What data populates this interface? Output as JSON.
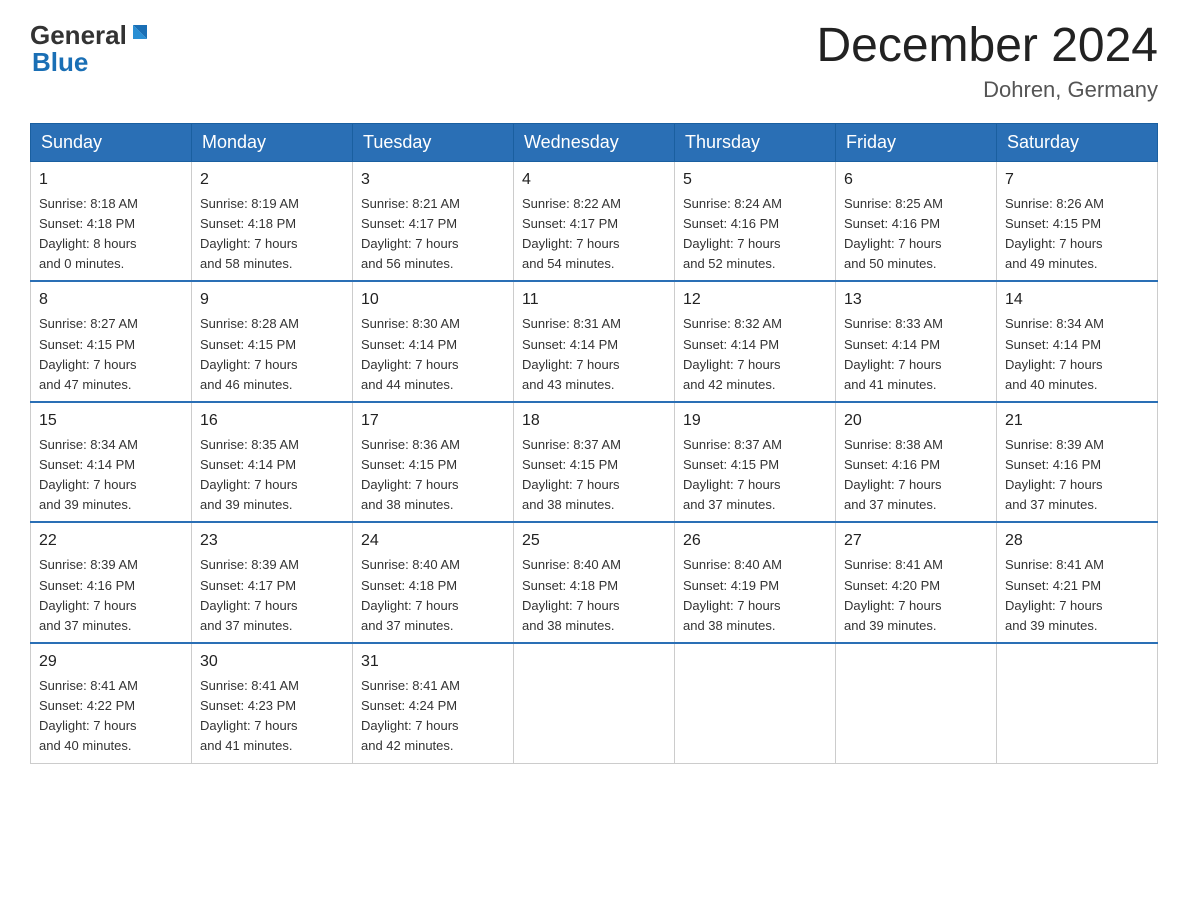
{
  "header": {
    "logo": {
      "text_general": "General",
      "text_blue": "Blue",
      "line2": "Blue"
    },
    "title": "December 2024",
    "subtitle": "Dohren, Germany"
  },
  "weekdays": [
    "Sunday",
    "Monday",
    "Tuesday",
    "Wednesday",
    "Thursday",
    "Friday",
    "Saturday"
  ],
  "weeks": [
    [
      {
        "day": "1",
        "info": "Sunrise: 8:18 AM\nSunset: 4:18 PM\nDaylight: 8 hours\nand 0 minutes."
      },
      {
        "day": "2",
        "info": "Sunrise: 8:19 AM\nSunset: 4:18 PM\nDaylight: 7 hours\nand 58 minutes."
      },
      {
        "day": "3",
        "info": "Sunrise: 8:21 AM\nSunset: 4:17 PM\nDaylight: 7 hours\nand 56 minutes."
      },
      {
        "day": "4",
        "info": "Sunrise: 8:22 AM\nSunset: 4:17 PM\nDaylight: 7 hours\nand 54 minutes."
      },
      {
        "day": "5",
        "info": "Sunrise: 8:24 AM\nSunset: 4:16 PM\nDaylight: 7 hours\nand 52 minutes."
      },
      {
        "day": "6",
        "info": "Sunrise: 8:25 AM\nSunset: 4:16 PM\nDaylight: 7 hours\nand 50 minutes."
      },
      {
        "day": "7",
        "info": "Sunrise: 8:26 AM\nSunset: 4:15 PM\nDaylight: 7 hours\nand 49 minutes."
      }
    ],
    [
      {
        "day": "8",
        "info": "Sunrise: 8:27 AM\nSunset: 4:15 PM\nDaylight: 7 hours\nand 47 minutes."
      },
      {
        "day": "9",
        "info": "Sunrise: 8:28 AM\nSunset: 4:15 PM\nDaylight: 7 hours\nand 46 minutes."
      },
      {
        "day": "10",
        "info": "Sunrise: 8:30 AM\nSunset: 4:14 PM\nDaylight: 7 hours\nand 44 minutes."
      },
      {
        "day": "11",
        "info": "Sunrise: 8:31 AM\nSunset: 4:14 PM\nDaylight: 7 hours\nand 43 minutes."
      },
      {
        "day": "12",
        "info": "Sunrise: 8:32 AM\nSunset: 4:14 PM\nDaylight: 7 hours\nand 42 minutes."
      },
      {
        "day": "13",
        "info": "Sunrise: 8:33 AM\nSunset: 4:14 PM\nDaylight: 7 hours\nand 41 minutes."
      },
      {
        "day": "14",
        "info": "Sunrise: 8:34 AM\nSunset: 4:14 PM\nDaylight: 7 hours\nand 40 minutes."
      }
    ],
    [
      {
        "day": "15",
        "info": "Sunrise: 8:34 AM\nSunset: 4:14 PM\nDaylight: 7 hours\nand 39 minutes."
      },
      {
        "day": "16",
        "info": "Sunrise: 8:35 AM\nSunset: 4:14 PM\nDaylight: 7 hours\nand 39 minutes."
      },
      {
        "day": "17",
        "info": "Sunrise: 8:36 AM\nSunset: 4:15 PM\nDaylight: 7 hours\nand 38 minutes."
      },
      {
        "day": "18",
        "info": "Sunrise: 8:37 AM\nSunset: 4:15 PM\nDaylight: 7 hours\nand 38 minutes."
      },
      {
        "day": "19",
        "info": "Sunrise: 8:37 AM\nSunset: 4:15 PM\nDaylight: 7 hours\nand 37 minutes."
      },
      {
        "day": "20",
        "info": "Sunrise: 8:38 AM\nSunset: 4:16 PM\nDaylight: 7 hours\nand 37 minutes."
      },
      {
        "day": "21",
        "info": "Sunrise: 8:39 AM\nSunset: 4:16 PM\nDaylight: 7 hours\nand 37 minutes."
      }
    ],
    [
      {
        "day": "22",
        "info": "Sunrise: 8:39 AM\nSunset: 4:16 PM\nDaylight: 7 hours\nand 37 minutes."
      },
      {
        "day": "23",
        "info": "Sunrise: 8:39 AM\nSunset: 4:17 PM\nDaylight: 7 hours\nand 37 minutes."
      },
      {
        "day": "24",
        "info": "Sunrise: 8:40 AM\nSunset: 4:18 PM\nDaylight: 7 hours\nand 37 minutes."
      },
      {
        "day": "25",
        "info": "Sunrise: 8:40 AM\nSunset: 4:18 PM\nDaylight: 7 hours\nand 38 minutes."
      },
      {
        "day": "26",
        "info": "Sunrise: 8:40 AM\nSunset: 4:19 PM\nDaylight: 7 hours\nand 38 minutes."
      },
      {
        "day": "27",
        "info": "Sunrise: 8:41 AM\nSunset: 4:20 PM\nDaylight: 7 hours\nand 39 minutes."
      },
      {
        "day": "28",
        "info": "Sunrise: 8:41 AM\nSunset: 4:21 PM\nDaylight: 7 hours\nand 39 minutes."
      }
    ],
    [
      {
        "day": "29",
        "info": "Sunrise: 8:41 AM\nSunset: 4:22 PM\nDaylight: 7 hours\nand 40 minutes."
      },
      {
        "day": "30",
        "info": "Sunrise: 8:41 AM\nSunset: 4:23 PM\nDaylight: 7 hours\nand 41 minutes."
      },
      {
        "day": "31",
        "info": "Sunrise: 8:41 AM\nSunset: 4:24 PM\nDaylight: 7 hours\nand 42 minutes."
      },
      {
        "day": "",
        "info": ""
      },
      {
        "day": "",
        "info": ""
      },
      {
        "day": "",
        "info": ""
      },
      {
        "day": "",
        "info": ""
      }
    ]
  ]
}
